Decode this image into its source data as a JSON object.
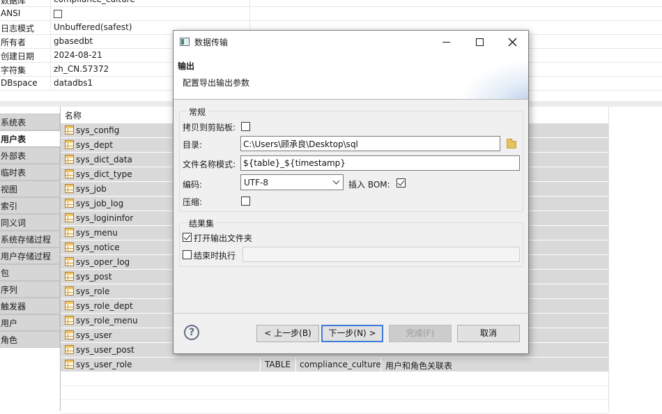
{
  "properties": [
    {
      "key": "数据库",
      "value": "compliance_culture"
    },
    {
      "key": "ANSI",
      "value": "",
      "checkbox": true
    },
    {
      "key": "日志模式",
      "value": "Unbuffered(safest)"
    },
    {
      "key": "所有者",
      "value": "gbasedbt"
    },
    {
      "key": "创建日期",
      "value": "2024-08-21"
    },
    {
      "key": "字符集",
      "value": "zh_CN.57372"
    },
    {
      "key": "DBspace",
      "value": "datadbs1"
    }
  ],
  "categories": [
    {
      "label": "系统表"
    },
    {
      "label": "用户表",
      "active": true
    },
    {
      "label": "外部表"
    },
    {
      "label": "临时表"
    },
    {
      "label": "视图"
    },
    {
      "label": "索引"
    },
    {
      "label": "同义词"
    },
    {
      "label": "系统存储过程"
    },
    {
      "label": "用户存储过程"
    },
    {
      "label": "包"
    },
    {
      "label": "序列"
    },
    {
      "label": "触发器"
    },
    {
      "label": "用户"
    },
    {
      "label": "角色"
    }
  ],
  "table_list": {
    "header_name": "名称",
    "rows": [
      {
        "name": "sys_config"
      },
      {
        "name": "sys_dept"
      },
      {
        "name": "sys_dict_data"
      },
      {
        "name": "sys_dict_type"
      },
      {
        "name": "sys_job"
      },
      {
        "name": "sys_job_log"
      },
      {
        "name": "sys_logininfor"
      },
      {
        "name": "sys_menu"
      },
      {
        "name": "sys_notice"
      },
      {
        "name": "sys_oper_log"
      },
      {
        "name": "sys_post"
      },
      {
        "name": "sys_role"
      },
      {
        "name": "sys_role_dept"
      },
      {
        "name": "sys_role_menu"
      },
      {
        "name": "sys_user"
      },
      {
        "name": "sys_user_post"
      },
      {
        "name": "sys_user_role",
        "type": "TABLE",
        "database": "compliance_culture",
        "comment": "用户和角色关联表"
      }
    ]
  },
  "dialog": {
    "title": "数据传输",
    "banner_title": "输出",
    "banner_desc": "配置导出输出参数",
    "general_group": "常规",
    "copy_to_clipboard_label": "拷贝到剪贴板:",
    "copy_to_clipboard_checked": false,
    "directory_label": "目录:",
    "directory_value": "C:\\Users\\顾承良\\Desktop\\sql",
    "filename_pattern_label": "文件名称模式:",
    "filename_pattern_value": "${table}_${timestamp}",
    "encoding_label": "编码:",
    "encoding_value": "UTF-8",
    "insert_bom_label": "插入 BOM:",
    "insert_bom_checked": true,
    "compress_label": "压缩:",
    "compress_checked": false,
    "result_group": "结果集",
    "open_folder_label": "打开输出文件夹",
    "open_folder_checked": true,
    "exec_on_finish_label": "结束时执行",
    "exec_on_finish_checked": false,
    "exec_on_finish_value": "",
    "buttons": {
      "back": "< 上一步(B)",
      "next": "下一步(N) >",
      "finish": "完成(F)",
      "cancel": "取消"
    },
    "help_glyph": "?"
  },
  "icons": {
    "help": "help-icon",
    "folder": "folder-icon",
    "table": "table-icon",
    "close": "close-icon",
    "maximize": "maximize-icon",
    "minimize": "minimize-icon"
  },
  "colors": {
    "default_button_border": "#3d7bd6",
    "row_background": "#d9d9d9"
  }
}
